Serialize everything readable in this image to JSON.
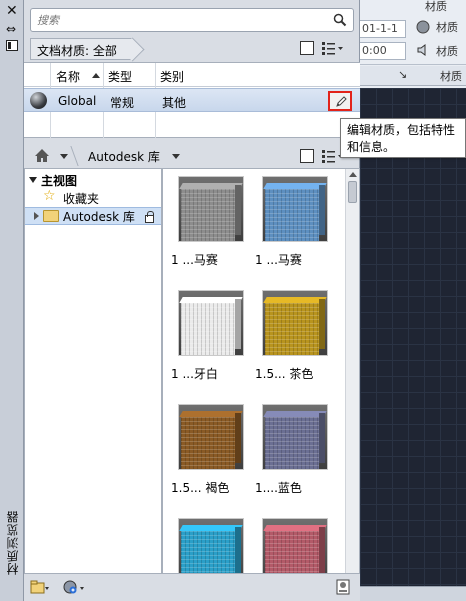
{
  "window": {
    "vertical_title": "材质浏览器"
  },
  "search": {
    "placeholder": "搜索"
  },
  "doc_materials": {
    "breadcrumb": "文档材质: 全部"
  },
  "table": {
    "headers": [
      "名称",
      "类型",
      "类别"
    ],
    "rows": [
      {
        "name": "Global",
        "type": "常规",
        "category": "其他"
      }
    ]
  },
  "tooltip": {
    "text": "编辑材质，包括特性和信息。",
    "line1": "编辑材质，包括特性",
    "line2": "和信息。"
  },
  "library_bar": {
    "crumb": "Autodesk 库"
  },
  "tree": {
    "root": "主视图",
    "items": [
      {
        "label": "收藏夹",
        "icon": "star-icon"
      },
      {
        "label": "Autodesk 库",
        "icon": "folder-icon",
        "locked": true
      }
    ]
  },
  "swatches": [
    {
      "label": "1 ...马赛",
      "color": "#8d8d8d"
    },
    {
      "label": "1 ...马赛",
      "color": "#5d8fc0"
    },
    {
      "label": "1 ...牙白",
      "color": "#ebebeb"
    },
    {
      "label": "1.5... 茶色",
      "color": "#b8941e"
    },
    {
      "label": "1.5... 褐色",
      "color": "#8a5a25"
    },
    {
      "label": "1....蓝色",
      "color": "#6b6f93"
    },
    {
      "label": "",
      "color": "#2a9fc8"
    },
    {
      "label": "",
      "color": "#b35a68"
    }
  ],
  "background": {
    "date_box": "01-1-1",
    "time_box": "0:00",
    "ribbon_items": [
      "材质",
      "材质",
      "材质"
    ],
    "ribbon_panel": "材质"
  }
}
